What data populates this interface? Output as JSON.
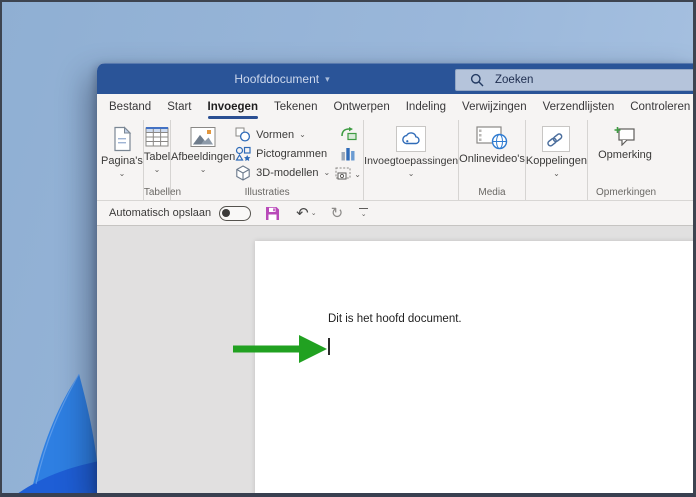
{
  "titlebar": {
    "document_title": "Hoofddocument",
    "title_caret": "▾",
    "search_placeholder": "Zoeken"
  },
  "tabs": [
    {
      "label": "Bestand",
      "active": false
    },
    {
      "label": "Start",
      "active": false
    },
    {
      "label": "Invoegen",
      "active": true
    },
    {
      "label": "Tekenen",
      "active": false
    },
    {
      "label": "Ontwerpen",
      "active": false
    },
    {
      "label": "Indeling",
      "active": false
    },
    {
      "label": "Verwijzingen",
      "active": false
    },
    {
      "label": "Verzendlijsten",
      "active": false
    },
    {
      "label": "Controleren",
      "active": false
    }
  ],
  "ribbon": {
    "chevron": "⌄",
    "paginas_label": "Pagina's",
    "tabel_label": "Tabel",
    "tabellen_group_label": "Tabellen",
    "afbeeldingen_label": "Afbeeldingen",
    "vormen_label": "Vormen",
    "pictogrammen_label": "Pictogrammen",
    "modellen_3d_label": "3D-modellen",
    "illustraties_group_label": "Illustraties",
    "invoegtoepassingen_label": "Invoegtoepassingen",
    "onlinevideos_label": "Onlinevideo's",
    "media_group_label": "Media",
    "koppelingen_label": "Koppelingen",
    "opmerking_label": "Opmerking",
    "opmerkingen_group_label": "Opmerkingen"
  },
  "quick_access": {
    "autosave_label": "Automatisch opslaan",
    "autosave_state": "off",
    "undo_glyph": "↶",
    "redo_glyph": "↻"
  },
  "document": {
    "body_text": "Dit is het hoofd document."
  },
  "colors": {
    "titlebar_blue": "#2a5498",
    "tab_underline": "#2b4f92",
    "search_box": "#b5c4db",
    "save_purple": "#b94ab9",
    "arrow_green": "#21a121",
    "wallpaper_light": "#a9c3e2",
    "wallpaper_deep": "#8fafd3",
    "bloom_bright": "#2e7fe2",
    "bloom_deep": "#1e5ed6",
    "doc_gray": "#e1e0e0"
  }
}
